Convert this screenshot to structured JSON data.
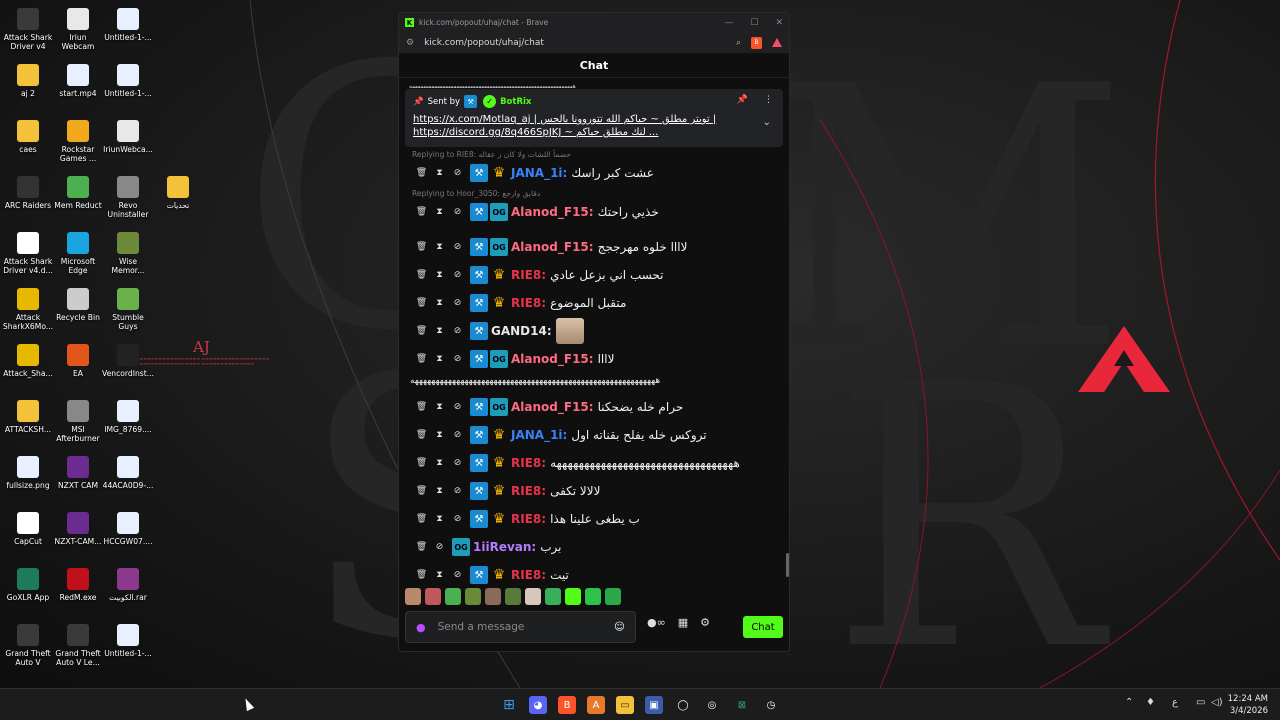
{
  "desktop": {
    "icons": [
      {
        "label": "Attack Shark Driver v4",
        "icon": "shark-app-icon",
        "color": "#3a3a3a"
      },
      {
        "label": "Iriun Webcam",
        "icon": "webcam-icon",
        "color": "#e8e8e8"
      },
      {
        "label": "Untitled-1-...",
        "icon": "image-file-icon",
        "color": "#e8f0ff"
      },
      {
        "label": "aj 2",
        "icon": "folder-icon",
        "color": "#f3c13a"
      },
      {
        "label": "start.mp4",
        "icon": "video-file-icon",
        "color": "#e8f0ff"
      },
      {
        "label": "Untitled-1-...",
        "icon": "image-file-icon",
        "color": "#e8f0ff"
      },
      {
        "label": "caes",
        "icon": "folder-icon",
        "color": "#f3c13a"
      },
      {
        "label": "Rockstar Games ...",
        "icon": "rockstar-icon",
        "color": "#f2a81c"
      },
      {
        "label": "IriunWebca...",
        "icon": "webcam-icon",
        "color": "#e8e8e8"
      },
      {
        "label": "ARC Raiders",
        "icon": "arc-raiders-icon",
        "color": "#333"
      },
      {
        "label": "Mem Reduct",
        "icon": "memory-icon",
        "color": "#4caf50"
      },
      {
        "label": "Revo Uninstaller",
        "icon": "revo-icon",
        "color": "#888"
      },
      {
        "label": "تحديات",
        "icon": "folder-icon",
        "color": "#f3c13a"
      },
      {
        "label": "Attack Shark Driver v4.d...",
        "icon": "document-icon",
        "color": "#fff"
      },
      {
        "label": "Microsoft Edge",
        "icon": "edge-icon",
        "color": "#1aa5e0"
      },
      {
        "label": "Wise Memor...",
        "icon": "wise-memory-icon",
        "color": "#6c8a3a"
      },
      {
        "label": "Attack SharkX6Mo...",
        "icon": "shark-app-icon",
        "color": "#e6b800"
      },
      {
        "label": "Recycle Bin",
        "icon": "recycle-bin-icon",
        "color": "#ccc"
      },
      {
        "label": "Stumble Guys",
        "icon": "stumble-guys-icon",
        "color": "#6ab04c"
      },
      {
        "label": "Attack_Sha...",
        "icon": "shark-app-icon",
        "color": "#e6b800"
      },
      {
        "label": "EA",
        "icon": "ea-icon",
        "color": "#e2561c"
      },
      {
        "label": "VencordInst...",
        "icon": "vencord-icon",
        "color": "#222"
      },
      {
        "label": "ATTACKSH...",
        "icon": "folder-icon",
        "color": "#f3c13a"
      },
      {
        "label": "MSI Afterburner",
        "icon": "msi-icon",
        "color": "#888"
      },
      {
        "label": "IMG_8769....",
        "icon": "image-file-icon",
        "color": "#e8f0ff"
      },
      {
        "label": "fullsize.png",
        "icon": "image-file-icon",
        "color": "#e8f0ff"
      },
      {
        "label": "NZXT CAM",
        "icon": "nzxt-icon",
        "color": "#6a2c91"
      },
      {
        "label": "44ACA0D9-...",
        "icon": "image-file-icon",
        "color": "#e8f0ff"
      },
      {
        "label": "CapCut",
        "icon": "capcut-icon",
        "color": "#fff"
      },
      {
        "label": "NZXT-CAM...",
        "icon": "nzxt-icon",
        "color": "#6a2c91"
      },
      {
        "label": "HCCGW07....",
        "icon": "image-file-icon",
        "color": "#e8f0ff"
      },
      {
        "label": "GoXLR App",
        "icon": "goxlr-icon",
        "color": "#1e7a5a"
      },
      {
        "label": "RedM.exe",
        "icon": "redm-icon",
        "color": "#c0101a"
      },
      {
        "label": "الكوبيت.rar",
        "icon": "rar-archive-icon",
        "color": "#8b3a8b"
      },
      {
        "label": "Grand Theft Auto V",
        "icon": "gta-icon",
        "color": "#3a3a3a"
      },
      {
        "label": "Grand Theft Auto V Le...",
        "icon": "gta-icon",
        "color": "#3a3a3a"
      },
      {
        "label": "Untitled-1-...",
        "icon": "image-file-icon",
        "color": "#e8f0ff"
      }
    ],
    "aj_mark": "AJ"
  },
  "browser": {
    "title": "kick.com/popout/uhaj/chat - Brave",
    "url": "kick.com/popout/uhaj/chat",
    "chat_header": "Chat"
  },
  "pinned": {
    "sent_by": "Sent by",
    "bot_name": "BotRix",
    "line1": "https://x.com/Motlaq_aj | تويتر مطلق ~ حياكم الله تتوروونا بالحس |",
    "line2": "https://discord.gg/8q466SpJKJ ~ لنك مطلق حياكم ..."
  },
  "messages": [
    {
      "reply": "Replying to RIE8: حضمأ اللشات ولا كان ز عقاله",
      "user": "JANA_1i",
      "color": "#3b82f6",
      "text": "عشت كبر راسك",
      "badges": [
        "mod",
        "crown"
      ]
    },
    {
      "reply": "Replying to Hoor_3050: دقايق وارجع",
      "user": "Alanod_F15",
      "color": "#ff6b81",
      "text": "خذيي راحتك",
      "badges": [
        "mod",
        "og"
      ]
    },
    {
      "user": "Alanod_F15",
      "color": "#ff6b81",
      "text": "لاااا خلوه مهرججج",
      "badges": [
        "mod",
        "og"
      ]
    },
    {
      "user": "RIE8",
      "color": "#e8334a",
      "text": "تحسب اني بزعل عادي",
      "badges": [
        "mod",
        "crown"
      ]
    },
    {
      "user": "RIE8",
      "color": "#e8334a",
      "text": "متقبل الموضوع",
      "badges": [
        "mod",
        "crown"
      ]
    },
    {
      "user": "GAND14",
      "color": "#e8e8e8",
      "text": "",
      "badges": [
        "mod"
      ],
      "emote": "baby-emote"
    },
    {
      "user": "Alanod_F15",
      "color": "#ff6b81",
      "text": "لاااا",
      "badges": [
        "mod",
        "og"
      ]
    },
    {
      "user": "Alanod_F15",
      "color": "#ff6b81",
      "text": "حرام خله يضحكنا",
      "badges": [
        "mod",
        "og"
      ]
    },
    {
      "user": "JANA_1i",
      "color": "#3b82f6",
      "text": "تروكس خله يفلح بقناته اول",
      "badges": [
        "mod",
        "crown"
      ]
    },
    {
      "user": "RIE8",
      "color": "#e8334a",
      "text": "هههههههههههههههههههههههههههههههههه",
      "badges": [
        "mod",
        "crown"
      ]
    },
    {
      "user": "RIE8",
      "color": "#e8334a",
      "text": "لالالا تكفى",
      "badges": [
        "mod",
        "crown"
      ]
    },
    {
      "user": "RIE8",
      "color": "#e8334a",
      "text": "ب يطغى علينا هذا",
      "badges": [
        "mod",
        "crown"
      ]
    },
    {
      "user": "1iiRevan",
      "color": "#b57cff",
      "text": "برب",
      "badges": [
        "og"
      ]
    },
    {
      "user": "RIE8",
      "color": "#e8334a",
      "text": "تيت",
      "badges": [
        "mod",
        "crown"
      ]
    }
  ],
  "separator_text": "هههههههههههههههههههههههههههههههههههههههههههههههههههههههههههه",
  "input": {
    "placeholder": "Send a message",
    "send_label": "Chat"
  },
  "taskbar": {
    "time": "12:24 AM",
    "date": "3/4/2026",
    "lang": "ع"
  }
}
